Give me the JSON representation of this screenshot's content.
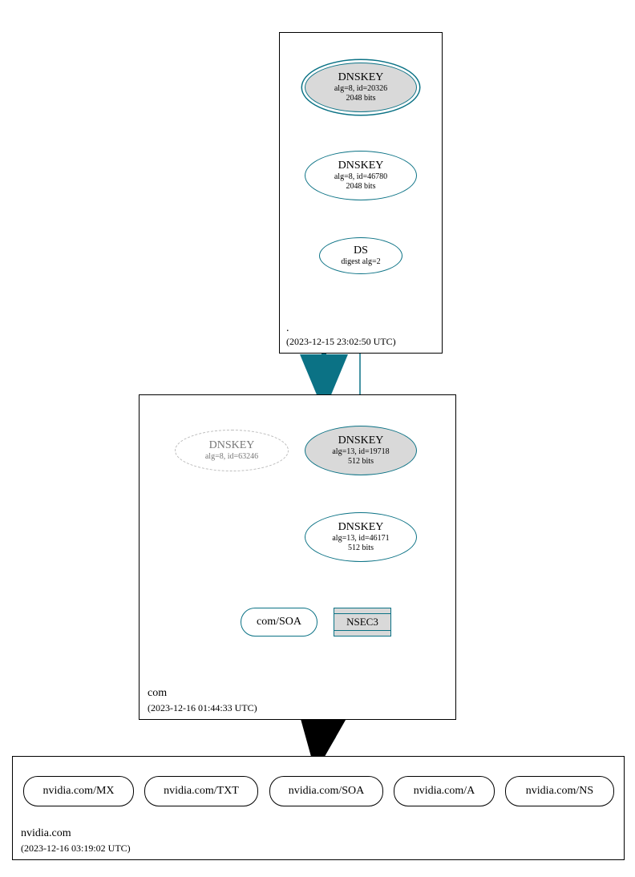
{
  "zones": {
    "root": {
      "label": ".",
      "date": "(2023-12-15 23:02:50 UTC)"
    },
    "com": {
      "label": "com",
      "date": "(2023-12-16 01:44:33 UTC)"
    },
    "nvidia": {
      "label": "nvidia.com",
      "date": "(2023-12-16 03:19:02 UTC)"
    }
  },
  "nodes": {
    "root_ksk": {
      "title": "DNSKEY",
      "sub1": "alg=8, id=20326",
      "sub2": "2048 bits"
    },
    "root_zsk": {
      "title": "DNSKEY",
      "sub1": "alg=8, id=46780",
      "sub2": "2048 bits"
    },
    "root_ds": {
      "title": "DS",
      "sub1": "digest alg=2"
    },
    "com_dnskey_old": {
      "title": "DNSKEY",
      "sub1": "alg=8, id=63246"
    },
    "com_ksk": {
      "title": "DNSKEY",
      "sub1": "alg=13, id=19718",
      "sub2": "512 bits"
    },
    "com_zsk": {
      "title": "DNSKEY",
      "sub1": "alg=13, id=46171",
      "sub2": "512 bits"
    },
    "com_soa": "com/SOA",
    "nsec3": "NSEC3",
    "nvidia_mx": "nvidia.com/MX",
    "nvidia_txt": "nvidia.com/TXT",
    "nvidia_soa": "nvidia.com/SOA",
    "nvidia_a": "nvidia.com/A",
    "nvidia_ns": "nvidia.com/NS"
  }
}
